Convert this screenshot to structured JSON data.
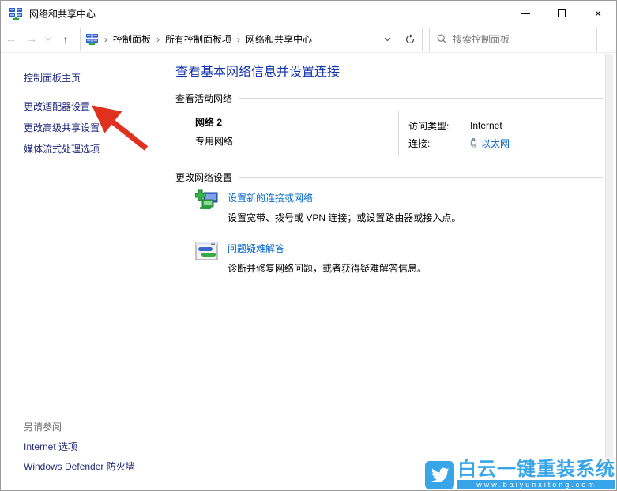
{
  "window": {
    "title": "网络和共享中心",
    "controls": {
      "minimize": "minimize",
      "maximize": "maximize",
      "close": "×"
    }
  },
  "toolbar": {
    "back_glyph": "←",
    "forward_glyph": "→",
    "up_glyph": "↑",
    "breadcrumb": {
      "separator": "›",
      "items": [
        "控制面板",
        "所有控制面板项",
        "网络和共享中心"
      ]
    },
    "search": {
      "placeholder": "搜索控制面板"
    }
  },
  "sidebar": {
    "home": "控制面板主页",
    "items": [
      {
        "label": "更改适配器设置"
      },
      {
        "label": "更改高级共享设置"
      },
      {
        "label": "媒体流式处理选项"
      }
    ]
  },
  "main": {
    "heading": "查看基本网络信息并设置连接",
    "active_networks": {
      "section_title": "查看活动网络",
      "network_name": "网络 2",
      "network_type": "专用网络",
      "details": [
        {
          "label": "访问类型:",
          "value": "Internet"
        },
        {
          "label": "连接:",
          "value": "以太网"
        }
      ]
    },
    "change_settings": {
      "section_title": "更改网络设置",
      "items": [
        {
          "link": "设置新的连接或网络",
          "desc": "设置宽带、拨号或 VPN 连接；或设置路由器或接入点。"
        },
        {
          "link": "问题疑难解答",
          "desc": "诊断并修复网络问题，或者获得疑难解答信息。"
        }
      ]
    }
  },
  "see_also": {
    "title": "另请参阅",
    "items": [
      "Internet 选项",
      "Windows Defender 防火墙"
    ]
  },
  "watermark": {
    "text": "白云一键重装系统",
    "url": "www.baiyunxitong.com"
  },
  "colors": {
    "heading_blue": "#1133ae",
    "sidebar_link": "#20297c",
    "content_link": "#0066cc",
    "annotation_arrow": "#e0301e",
    "watermark_blue": "#38a5e9"
  }
}
